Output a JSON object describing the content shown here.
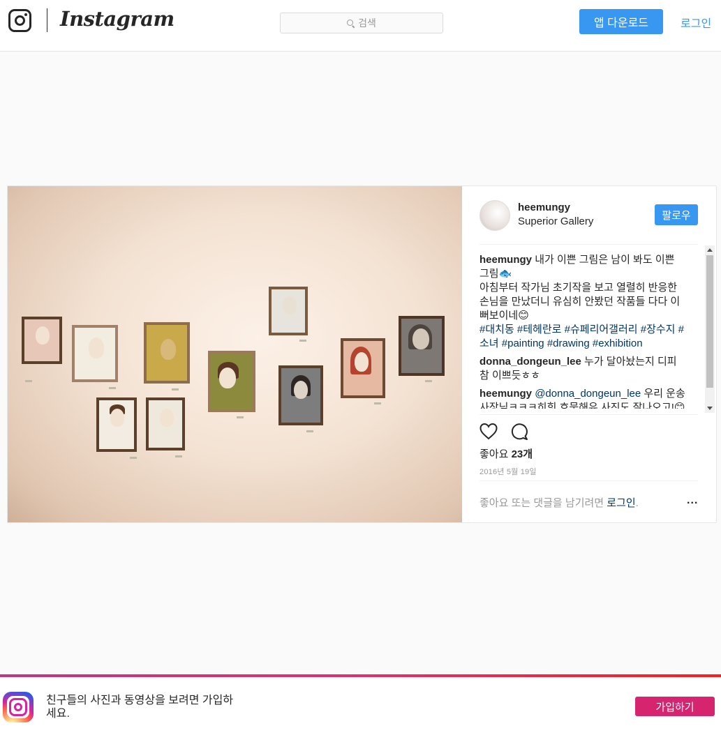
{
  "header": {
    "brand": "Instagram",
    "search_placeholder": "검색",
    "download_label": "앱 다운로드",
    "login_label": "로그인"
  },
  "post": {
    "username": "heemungy",
    "location": "Superior Gallery",
    "follow_label": "팔로우",
    "comments": [
      {
        "user": "heemungy",
        "text": "내가 이쁜 그림은 남이 봐도 이쁜 그림🐟\n아침부터 작가님 초기작을 보고 열렬히 반응한 손님을 만났더니 유심히 안봤던 작품들 다다 이뻐보이네😊",
        "tags": "#대치동 #테헤란로 #슈페리어갤러리 #장수지 #소녀 #painting #drawing #exhibition"
      },
      {
        "user": "donna_dongeun_lee",
        "text": "누가 달아놨는지 디피 참 이쁘듯ㅎㅎ"
      },
      {
        "user": "heemungy",
        "mention": "@donna_dongeun_lee",
        "text": "우리 운송사장님ㅋㅋㅋ히힛 흐뭇해유 사진도 잘나오고!😊"
      }
    ],
    "likes_prefix": "좋아요",
    "likes_count": "23개",
    "date": "2016년 5월 19일",
    "login_prompt": "좋아요 또는 댓글을 남기려면",
    "login_link": "로그인",
    "login_suffix": ".",
    "more_label": "..."
  },
  "banner": {
    "text": "친구들의 사진과 동영상을 보려면 가입하세요.",
    "signup_label": "가입하기"
  },
  "colors": {
    "accent": "#3897f0",
    "signup": "#d6246e",
    "link": "#003569"
  },
  "icons": [
    "instagram-glyph-icon",
    "search-icon",
    "heart-icon",
    "comment-icon",
    "more-icon",
    "instagram-app-icon"
  ]
}
